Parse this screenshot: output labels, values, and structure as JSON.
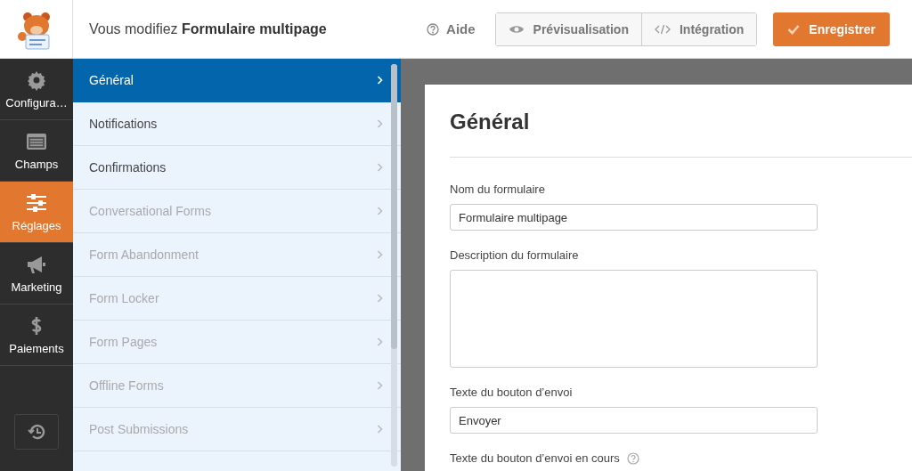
{
  "header": {
    "title": "Vous modifiez **Formulaire multipage**",
    "help": "Aide",
    "buttons": [
      {
        "label": "Prévisualisation",
        "kind": "preview"
      },
      {
        "label": "Intégration",
        "kind": "embed"
      }
    ],
    "save": "Enregistrer"
  },
  "nav": [
    {
      "label": "Configura…",
      "kind": "setup",
      "selected": false
    },
    {
      "label": "Champs",
      "kind": "fields",
      "selected": false
    },
    {
      "label": "Réglages",
      "kind": "settings",
      "selected": true
    },
    {
      "label": "Marketing",
      "kind": "marketing",
      "selected": false
    },
    {
      "label": "Paiements",
      "kind": "payments",
      "selected": false
    }
  ],
  "sidebar": {
    "items": [
      {
        "label": "Général",
        "selected": true,
        "disabled": false
      },
      {
        "label": "Notifications",
        "selected": false,
        "disabled": false
      },
      {
        "label": "Confirmations",
        "selected": false,
        "disabled": false
      },
      {
        "label": "Conversational Forms",
        "selected": false,
        "disabled": true
      },
      {
        "label": "Form Abandonment",
        "selected": false,
        "disabled": true
      },
      {
        "label": "Form Locker",
        "selected": false,
        "disabled": true
      },
      {
        "label": "Form Pages",
        "selected": false,
        "disabled": true
      },
      {
        "label": "Offline Forms",
        "selected": false,
        "disabled": true
      },
      {
        "label": "Post Submissions",
        "selected": false,
        "disabled": true
      }
    ]
  },
  "panel": {
    "title": "Général",
    "fields": [
      {
        "kind": "text",
        "label": "Nom du formulaire",
        "value": "Formulaire multipage"
      },
      {
        "kind": "textarea",
        "label": "Description du formulaire"
      },
      {
        "kind": "text",
        "label": "Texte du bouton d’envoi",
        "value": "Envoyer"
      },
      {
        "kind": "label",
        "label": "Texte du bouton d’envoi en cours",
        "help": true
      }
    ]
  }
}
